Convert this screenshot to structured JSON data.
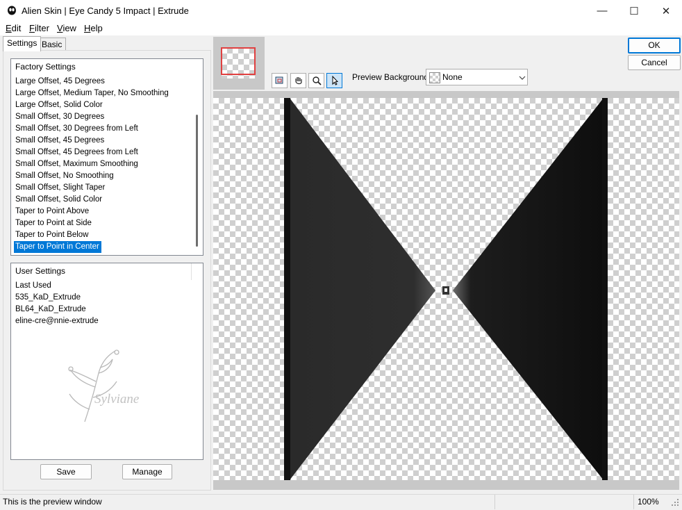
{
  "window": {
    "title": "Alien Skin | Eye Candy 5 Impact | Extrude",
    "minimize_glyph": "—",
    "maximize_glyph": "☐",
    "close_glyph": "✕"
  },
  "menu": {
    "edit": {
      "key": "E",
      "rest": "dit"
    },
    "filter": {
      "key": "F",
      "rest": "ilter"
    },
    "view": {
      "key": "V",
      "rest": "iew"
    },
    "help": {
      "key": "H",
      "rest": "elp"
    }
  },
  "tabs": {
    "settings": "Settings",
    "basic": "Basic"
  },
  "factory": {
    "header": "Factory Settings",
    "items": [
      "Large Offset, 45 Degrees",
      "Large Offset, Medium Taper, No Smoothing",
      "Large Offset, Solid Color",
      "Small Offset, 30 Degrees",
      "Small Offset, 30 Degrees from Left",
      "Small Offset, 45 Degrees",
      "Small Offset, 45 Degrees from Left",
      "Small Offset, Maximum Smoothing",
      "Small Offset, No Smoothing",
      "Small Offset, Slight Taper",
      "Small Offset, Solid Color",
      "Taper to Point Above",
      "Taper to Point at Side",
      "Taper to Point Below",
      "Taper to Point in Center"
    ]
  },
  "user": {
    "header": "User Settings",
    "items": [
      "Last Used",
      "535_KaD_Extrude",
      "BL64_KaD_Extrude",
      "eline-cre@nnie-extrude"
    ],
    "watermark": "Sylviane"
  },
  "buttons": {
    "save": "Save",
    "manage": "Manage",
    "ok": "OK",
    "cancel": "Cancel"
  },
  "preview": {
    "background_label": "Preview Background:",
    "background_value": "None"
  },
  "status": {
    "text": "This is the preview window",
    "zoom": "100%"
  },
  "colors": {
    "selection": "#0078d7",
    "thumb_frame": "#e04040"
  }
}
